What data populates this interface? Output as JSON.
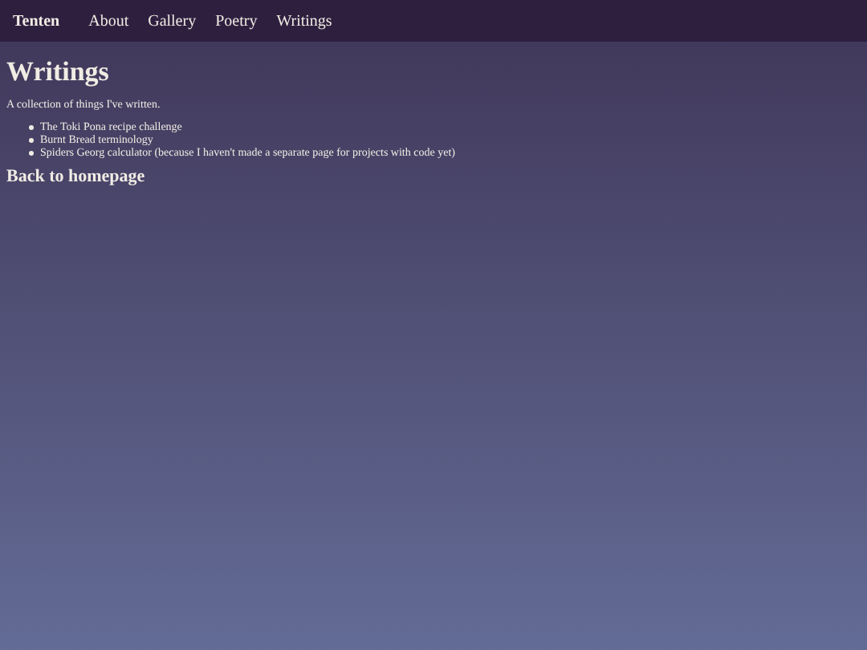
{
  "nav": {
    "brand": "Tenten",
    "links": [
      {
        "label": "About"
      },
      {
        "label": "Gallery"
      },
      {
        "label": "Poetry"
      },
      {
        "label": "Writings"
      }
    ]
  },
  "heading": "Writings",
  "intro": "A collection of things I've written.",
  "items": [
    {
      "label": "The Toki Pona recipe challenge"
    },
    {
      "label": "Burnt Bread terminology"
    },
    {
      "label": "Spiders Georg calculator (because I haven't made a separate page for projects with code yet)"
    }
  ],
  "back_link": "Back to homepage"
}
